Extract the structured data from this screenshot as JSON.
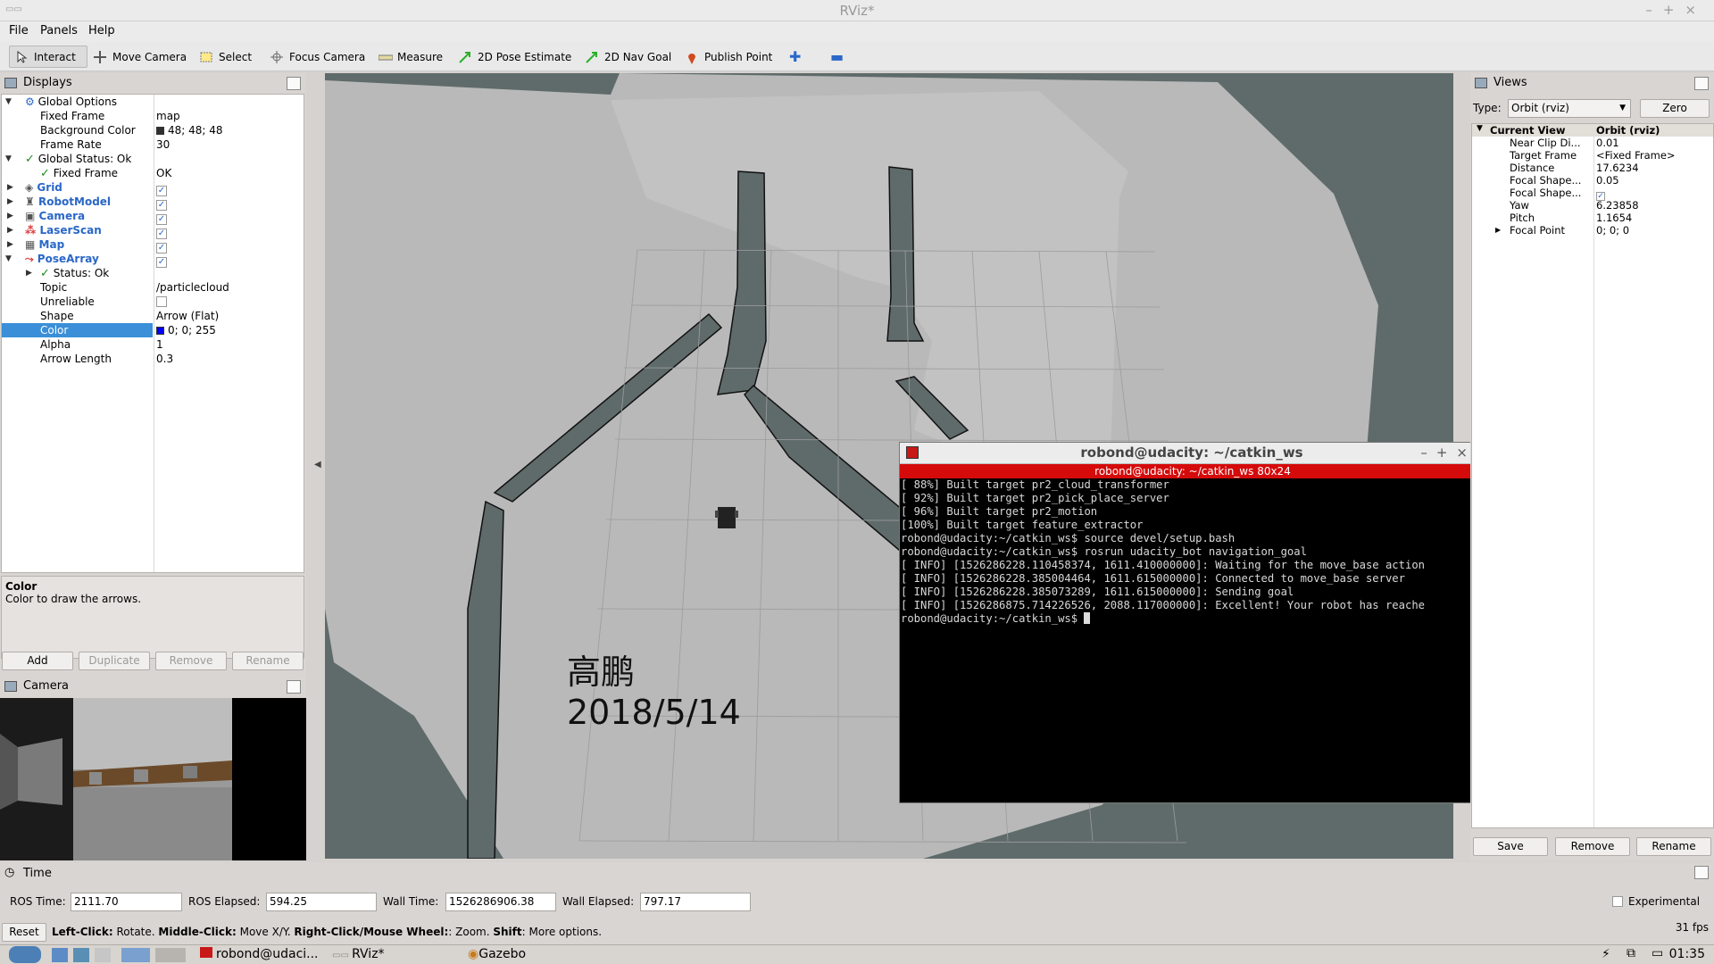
{
  "window": {
    "title": "RViz*",
    "controls": [
      "–",
      "+",
      "×"
    ]
  },
  "menu": [
    "File",
    "Panels",
    "Help"
  ],
  "toolbar": {
    "tools": [
      "Interact",
      "Move Camera",
      "Select",
      "Focus Camera",
      "Measure",
      "2D Pose Estimate",
      "2D Nav Goal",
      "Publish Point"
    ],
    "active": "Interact"
  },
  "displays": {
    "title": "Displays",
    "rows": [
      {
        "key": "Global Options",
        "value": ""
      },
      {
        "key": "Fixed Frame",
        "value": "map"
      },
      {
        "key": "Background Color",
        "value": "48; 48; 48"
      },
      {
        "key": "Frame Rate",
        "value": "30"
      },
      {
        "key": "Global Status: Ok",
        "value": ""
      },
      {
        "key": "Fixed Frame",
        "value": "OK"
      },
      {
        "key": "Grid",
        "value": ""
      },
      {
        "key": "RobotModel",
        "value": ""
      },
      {
        "key": "Camera",
        "value": ""
      },
      {
        "key": "LaserScan",
        "value": ""
      },
      {
        "key": "Map",
        "value": ""
      },
      {
        "key": "PoseArray",
        "value": ""
      },
      {
        "key": "Status: Ok",
        "value": ""
      },
      {
        "key": "Topic",
        "value": "/particlecloud"
      },
      {
        "key": "Unreliable",
        "value": ""
      },
      {
        "key": "Shape",
        "value": "Arrow (Flat)"
      },
      {
        "key": "Color",
        "value": "0; 0; 255"
      },
      {
        "key": "Alpha",
        "value": "1"
      },
      {
        "key": "Arrow Length",
        "value": "0.3"
      }
    ],
    "colors": {
      "background_swatch": "#303030",
      "color_swatch": "#0000ff"
    }
  },
  "help": {
    "title": "Color",
    "text": "Color to draw the arrows."
  },
  "display_buttons": [
    "Add",
    "Duplicate",
    "Remove",
    "Rename"
  ],
  "camera_panel": {
    "title": "Camera"
  },
  "overlay": {
    "name": "高鹏",
    "date": "2018/5/14"
  },
  "terminal": {
    "title": "robond@udacity: ~/catkin_ws",
    "tab": "robond@udacity: ~/catkin_ws 80x24",
    "lines": [
      "[ 88%] Built target pr2_cloud_transformer",
      "[ 92%] Built target pr2_pick_place_server",
      "[ 96%] Built target pr2_motion",
      "[100%] Built target feature_extractor",
      "robond@udacity:~/catkin_ws$ source devel/setup.bash",
      "robond@udacity:~/catkin_ws$ rosrun udacity_bot navigation_goal",
      "[ INFO] [1526286228.110458374, 1611.410000000]: Waiting for the move_base action",
      "[ INFO] [1526286228.385004464, 1611.615000000]: Connected to move_base server",
      "[ INFO] [1526286228.385073289, 1611.615000000]: Sending goal",
      "[ INFO] [1526286875.714226526, 2088.117000000]: Excellent! Your robot has reache",
      "robond@udacity:~/catkin_ws$ "
    ]
  },
  "views": {
    "title": "Views",
    "type_label": "Type:",
    "type_value": "Orbit (rviz)",
    "zero_label": "Zero",
    "header": {
      "key": "Current View",
      "value": "Orbit (rviz)"
    },
    "rows": [
      {
        "key": "Near Clip Di...",
        "value": "0.01"
      },
      {
        "key": "Target Frame",
        "value": "<Fixed Frame>"
      },
      {
        "key": "Distance",
        "value": "17.6234"
      },
      {
        "key": "Focal Shape...",
        "value": "0.05"
      },
      {
        "key": "Focal Shape...",
        "value": ""
      },
      {
        "key": "Yaw",
        "value": "6.23858"
      },
      {
        "key": "Pitch",
        "value": "1.1654"
      },
      {
        "key": "Focal Point",
        "value": "0; 0; 0"
      }
    ],
    "buttons": [
      "Save",
      "Remove",
      "Rename"
    ]
  },
  "time": {
    "title": "Time",
    "ros_time_label": "ROS Time:",
    "ros_time": "2111.70",
    "ros_elapsed_label": "ROS Elapsed:",
    "ros_elapsed": "594.25",
    "wall_time_label": "Wall Time:",
    "wall_time": "1526286906.38",
    "wall_elapsed_label": "Wall Elapsed:",
    "wall_elapsed": "797.17",
    "experimental": "Experimental"
  },
  "status": {
    "reset": "Reset",
    "b1": "Left-Click:",
    "t1": " Rotate. ",
    "b2": "Middle-Click:",
    "t2": " Move X/Y. ",
    "b3": "Right-Click/Mouse Wheel:",
    "t3": ": Zoom. ",
    "b4": "Shift",
    "t4": ": More options.",
    "fps": "31 fps"
  },
  "taskbar": {
    "items": [
      "robond@udaci...",
      "RViz*",
      "Gazebo"
    ],
    "clock": "01:35"
  }
}
